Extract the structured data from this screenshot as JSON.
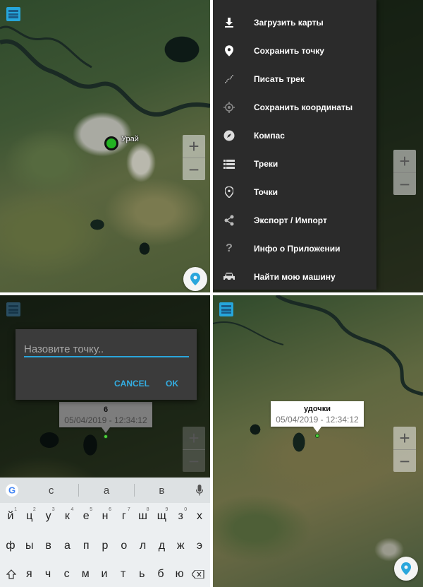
{
  "panel1": {
    "town_label": "Урай",
    "zoom_in": "+",
    "zoom_out": "−"
  },
  "panel2": {
    "menu_items": [
      {
        "label": "Загрузить карты",
        "icon": "download-icon"
      },
      {
        "label": "Сохранить точку",
        "icon": "location-pin-icon"
      },
      {
        "label": "Писать трек",
        "icon": "track-path-icon"
      },
      {
        "label": "Сохранить координаты",
        "icon": "crosshair-icon"
      },
      {
        "label": "Компас",
        "icon": "compass-icon"
      },
      {
        "label": "Треки",
        "icon": "list-icon"
      },
      {
        "label": "Точки",
        "icon": "place-pin-icon"
      },
      {
        "label": "Экспорт / Импорт",
        "icon": "share-icon"
      },
      {
        "label": "Инфо о Приложении",
        "icon": "help-icon"
      },
      {
        "label": "Найти мою машину",
        "icon": "car-icon"
      }
    ],
    "zoom_in": "+",
    "zoom_out": "−"
  },
  "panel3": {
    "dialog": {
      "placeholder": "Назовите точку..",
      "cancel": "CANCEL",
      "ok": "OK"
    },
    "infowin": {
      "title": "6",
      "date": "05/04/2019 - 12:34:12"
    },
    "zoom_in": "+",
    "zoom_out": "−",
    "keyboard": {
      "suggestions": [
        "с",
        "а",
        "в"
      ],
      "row1": [
        {
          "k": "й",
          "n": "1"
        },
        {
          "k": "ц",
          "n": "2"
        },
        {
          "k": "у",
          "n": "3"
        },
        {
          "k": "к",
          "n": "4"
        },
        {
          "k": "е",
          "n": "5"
        },
        {
          "k": "н",
          "n": "6"
        },
        {
          "k": "г",
          "n": "7"
        },
        {
          "k": "ш",
          "n": "8"
        },
        {
          "k": "щ",
          "n": "9"
        },
        {
          "k": "з",
          "n": "0"
        },
        {
          "k": "х",
          "n": ""
        }
      ],
      "row2": [
        "ф",
        "ы",
        "в",
        "а",
        "п",
        "р",
        "о",
        "л",
        "д",
        "ж",
        "э"
      ],
      "row3": [
        "я",
        "ч",
        "с",
        "м",
        "и",
        "т",
        "ь",
        "б",
        "ю"
      ]
    }
  },
  "panel4": {
    "infowin": {
      "title": "удочки",
      "date": "05/04/2019 - 12:34:12"
    },
    "zoom_in": "+",
    "zoom_out": "−"
  },
  "colors": {
    "accent": "#26a6db",
    "drawer_bg": "#2b2b2b",
    "dialog_bg": "#3b3b3b",
    "marker_green": "#23b322"
  }
}
